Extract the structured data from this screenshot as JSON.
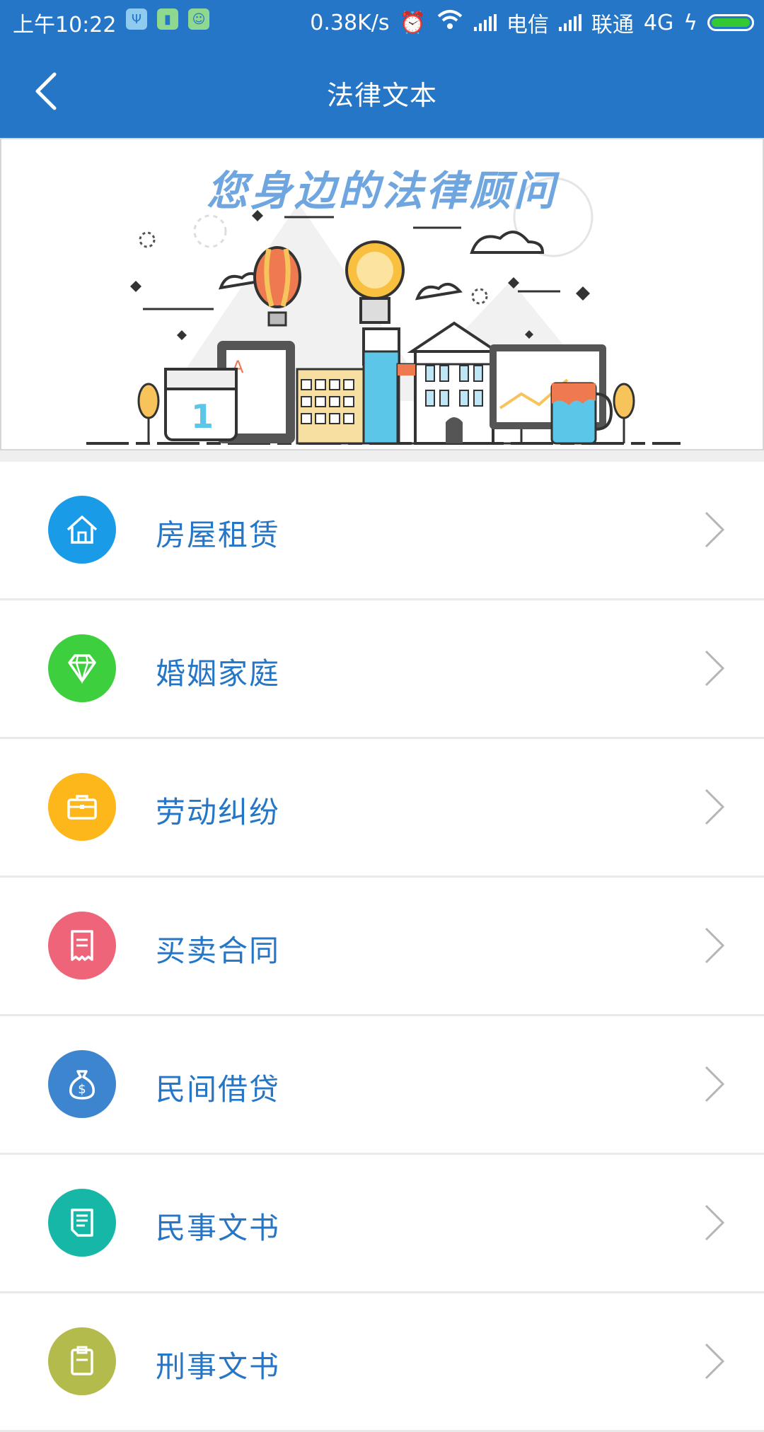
{
  "status_bar": {
    "time": "上午10:22",
    "net_speed": "0.38K/s",
    "carrier1": "电信",
    "carrier2": "联通",
    "network": "4G"
  },
  "nav": {
    "title": "法律文本",
    "back_icon": "chevron-left-icon"
  },
  "banner": {
    "headline": "您身边的法律顾问"
  },
  "menu": [
    {
      "label": "房屋租赁",
      "icon": "house-icon",
      "color": "#1a9be8"
    },
    {
      "label": "婚姻家庭",
      "icon": "diamond-icon",
      "color": "#3ecf3e"
    },
    {
      "label": "劳动纠纷",
      "icon": "briefcase-icon",
      "color": "#fdb71a"
    },
    {
      "label": "买卖合同",
      "icon": "receipt-icon",
      "color": "#ee6478"
    },
    {
      "label": "民间借贷",
      "icon": "money-bag-icon",
      "color": "#3d86cf"
    },
    {
      "label": "民事文书",
      "icon": "document-icon",
      "color": "#16b7a6"
    },
    {
      "label": "刑事文书",
      "icon": "clipboard-icon",
      "color": "#b3bb4d"
    }
  ],
  "colors": {
    "primary": "#2576c6",
    "divider": "#e9e9e9",
    "chevron": "#b5b5b5"
  }
}
